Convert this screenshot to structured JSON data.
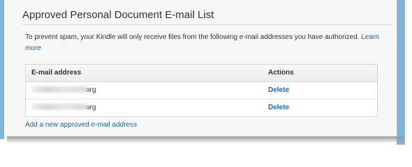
{
  "section": {
    "title": "Approved Personal Document E-mail List",
    "description": "To prevent spam, your Kindle will only receive files from the following e-mail addresses you have authorized.",
    "learn_more": "Learn more"
  },
  "table": {
    "headers": [
      "E-mail address",
      "Actions"
    ],
    "rows": [
      {
        "email_suffix": "org",
        "action": "Delete"
      },
      {
        "email_suffix": "org",
        "action": "Delete"
      }
    ]
  },
  "add_link": "Add a new approved e-mail address",
  "colors": {
    "link": "#1a69a6",
    "frame_accent": "#7fb4dd",
    "panel_bg": "#f7f7f7"
  }
}
